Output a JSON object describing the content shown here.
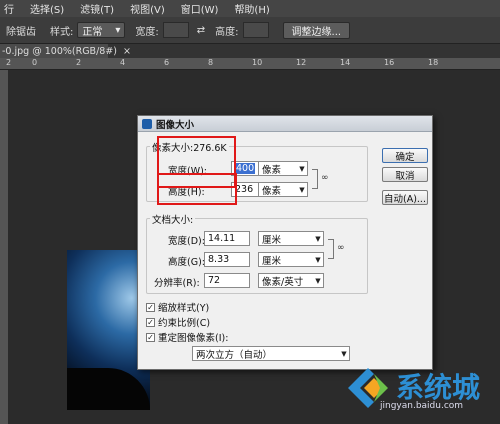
{
  "menubar": {
    "items": [
      "行",
      "选择(S)",
      "滤镜(T)",
      "视图(V)",
      "窗口(W)",
      "帮助(H)"
    ]
  },
  "options": {
    "anti_alias": "除锯齿",
    "style_label": "样式:",
    "style_value": "正常",
    "width_label": "宽度:",
    "height_label": "高度:",
    "refine_edge": "调整边缘..."
  },
  "doc_tab": {
    "title": "-0.jpg @ 100%(RGB/8#)",
    "close": "×"
  },
  "ruler": {
    "ticks": [
      "2",
      "0",
      "2",
      "4",
      "6",
      "8",
      "10",
      "12",
      "14",
      "16",
      "18"
    ]
  },
  "dialog": {
    "title": "图像大小",
    "pixel_dims_label": "像素大小:276.6K",
    "px_width_label": "宽度(W):",
    "px_width_value": "400",
    "px_height_label": "高度(H):",
    "px_height_value": "236",
    "px_unit": "像素",
    "doc_size_label": "文档大小:",
    "doc_width_label": "宽度(D):",
    "doc_width_value": "14.11",
    "doc_height_label": "高度(G):",
    "doc_height_value": "8.33",
    "doc_unit": "厘米",
    "resolution_label": "分辨率(R):",
    "resolution_value": "72",
    "resolution_unit": "像素/英寸",
    "ok": "确定",
    "cancel": "取消",
    "auto": "自动(A)...",
    "scale_styles": "缩放样式(Y)",
    "constrain": "约束比例(C)",
    "resample": "重定图像像素(I):",
    "resample_method": "两次立方（自动）",
    "check_mark": "✓"
  },
  "watermark": {
    "brand": "系统城",
    "site": "jingyan.baidu.com"
  },
  "colors": {
    "highlight": "#e01818",
    "brand_blue": "#2d8fd4"
  },
  "icons": {
    "link": "chain-link-icon",
    "swap": "swap-arrows-icon"
  }
}
